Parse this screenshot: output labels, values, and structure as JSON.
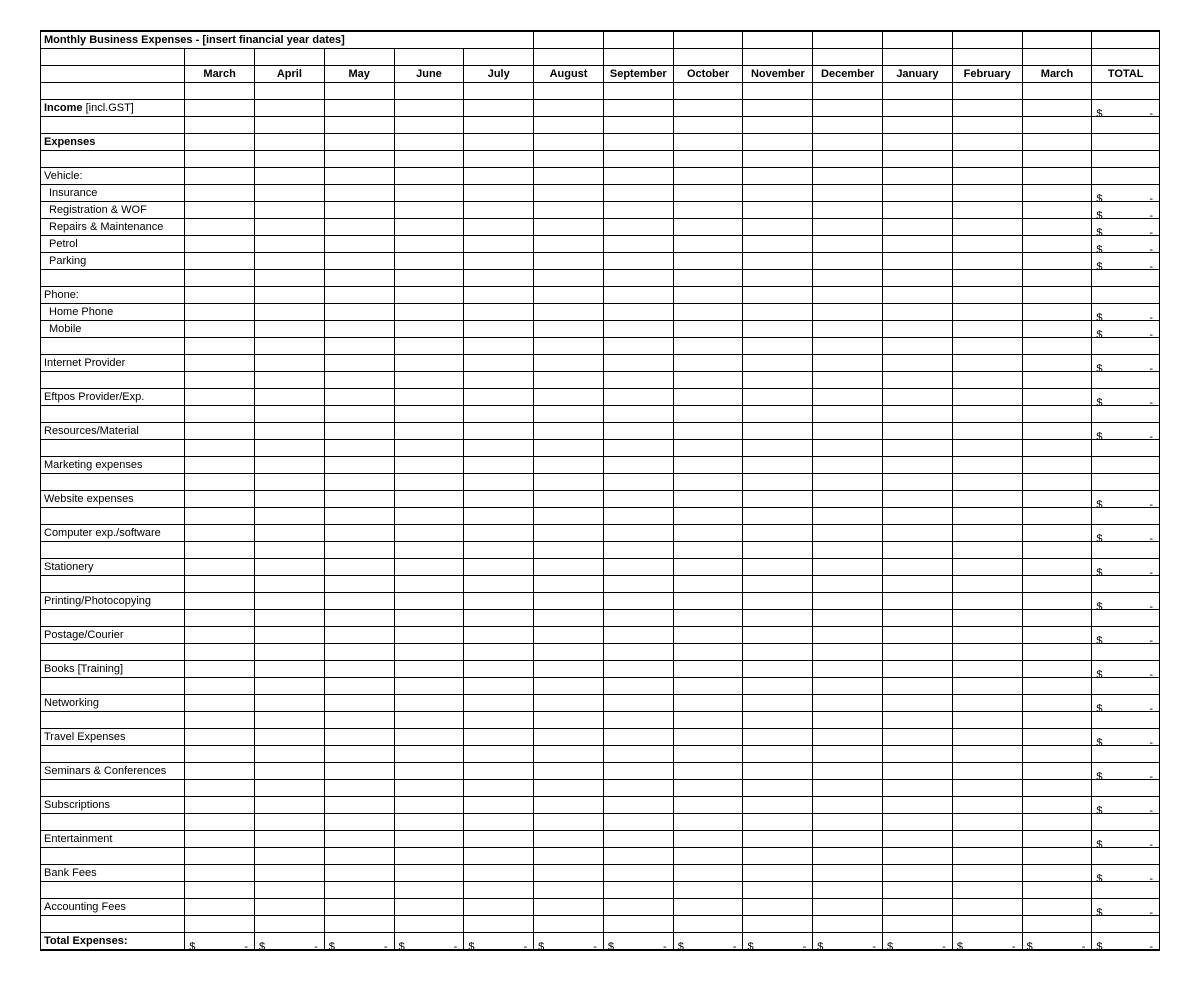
{
  "title": "Monthly Business Expenses - [insert financial year dates]",
  "months": [
    "March",
    "April",
    "May",
    "June",
    "July",
    "August",
    "September",
    "October",
    "November",
    "December",
    "January",
    "February",
    "March"
  ],
  "total_label": "TOTAL",
  "currency": "$",
  "dash": "-",
  "rows": [
    {
      "type": "spacer"
    },
    {
      "type": "line",
      "label": "Income [incl.GST]",
      "bold_prefix": "Income",
      "suffix": " [incl.GST]",
      "total": true
    },
    {
      "type": "spacer"
    },
    {
      "type": "section",
      "label": "Expenses"
    },
    {
      "type": "spacer"
    },
    {
      "type": "group",
      "label": "Vehicle:"
    },
    {
      "type": "item",
      "label": "Insurance",
      "total": true
    },
    {
      "type": "item",
      "label": "Registration & WOF",
      "total": true
    },
    {
      "type": "item",
      "label": "Repairs & Maintenance",
      "total": true
    },
    {
      "type": "item",
      "label": "Petrol",
      "total": true
    },
    {
      "type": "item",
      "label": "Parking",
      "total": true
    },
    {
      "type": "spacer"
    },
    {
      "type": "group",
      "label": "Phone:"
    },
    {
      "type": "item",
      "label": "Home Phone",
      "total": true
    },
    {
      "type": "item",
      "label": "Mobile",
      "total": true
    },
    {
      "type": "spacer"
    },
    {
      "type": "line",
      "label": "Internet Provider",
      "total": true
    },
    {
      "type": "spacer"
    },
    {
      "type": "line",
      "label": "Eftpos Provider/Exp.",
      "total": true
    },
    {
      "type": "spacer"
    },
    {
      "type": "line",
      "label": "Resources/Material",
      "total": true
    },
    {
      "type": "spacer"
    },
    {
      "type": "line",
      "label": "Marketing expenses",
      "total": false
    },
    {
      "type": "spacer"
    },
    {
      "type": "line",
      "label": "Website expenses",
      "total": true
    },
    {
      "type": "spacer"
    },
    {
      "type": "line",
      "label": "Computer exp./software",
      "total": true
    },
    {
      "type": "spacer"
    },
    {
      "type": "line",
      "label": "Stationery",
      "total": true
    },
    {
      "type": "spacer"
    },
    {
      "type": "line",
      "label": "Printing/Photocopying",
      "total": true
    },
    {
      "type": "spacer"
    },
    {
      "type": "line",
      "label": "Postage/Courier",
      "total": true
    },
    {
      "type": "spacer"
    },
    {
      "type": "line",
      "label": "Books [Training]",
      "total": true
    },
    {
      "type": "spacer"
    },
    {
      "type": "line",
      "label": "Networking",
      "total": true
    },
    {
      "type": "spacer"
    },
    {
      "type": "line",
      "label": "Travel Expenses",
      "total": true
    },
    {
      "type": "spacer"
    },
    {
      "type": "line",
      "label": "Seminars & Conferences",
      "total": true
    },
    {
      "type": "spacer"
    },
    {
      "type": "line",
      "label": "Subscriptions",
      "total": true
    },
    {
      "type": "spacer"
    },
    {
      "type": "line",
      "label": "Entertainment",
      "total": true
    },
    {
      "type": "spacer"
    },
    {
      "type": "line",
      "label": "Bank Fees",
      "total": true
    },
    {
      "type": "spacer"
    },
    {
      "type": "line",
      "label": "Accounting Fees",
      "total": true
    },
    {
      "type": "spacer"
    }
  ],
  "footer": {
    "label": "Total Expenses:",
    "months_money": true,
    "total": true
  }
}
